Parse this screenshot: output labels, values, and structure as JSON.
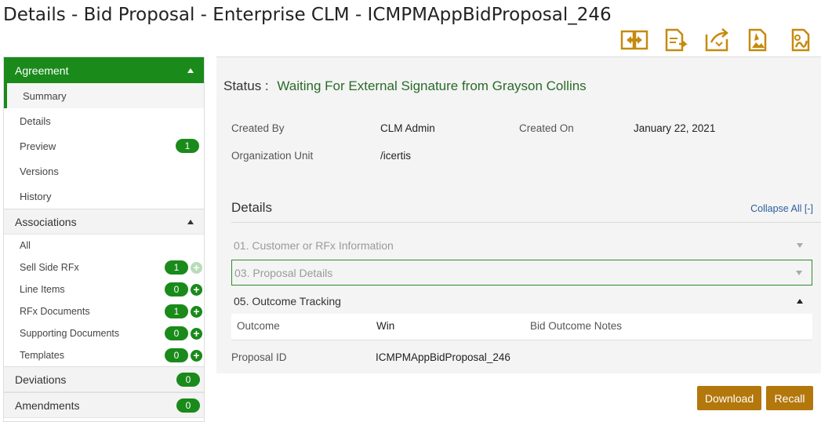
{
  "page_title": "Details - Bid Proposal - Enterprise CLM - ICMPMAppBidProposal_246",
  "toolbar": {
    "icons": [
      "compare-icon",
      "assign-icon",
      "send-icon",
      "image-edit-icon",
      "document-sign-icon"
    ],
    "accent": "#c58a0f"
  },
  "sidebar": {
    "agreement": {
      "label": "Agreement",
      "items": [
        {
          "label": "Summary"
        },
        {
          "label": "Details"
        },
        {
          "label": "Preview",
          "badge": "1"
        },
        {
          "label": "Versions"
        },
        {
          "label": "History"
        }
      ]
    },
    "associations": {
      "label": "Associations",
      "items": [
        {
          "label": "All"
        },
        {
          "label": "Sell Side RFx",
          "badge": "1"
        },
        {
          "label": "Line Items",
          "badge": "0"
        },
        {
          "label": "RFx Documents",
          "badge": "1"
        },
        {
          "label": "Supporting Documents",
          "badge": "0"
        },
        {
          "label": "Templates",
          "badge": "0"
        }
      ]
    },
    "deviations": {
      "label": "Deviations",
      "badge": "0"
    },
    "amendments": {
      "label": "Amendments",
      "badge": "0"
    }
  },
  "main": {
    "status_label": "Status :",
    "status_value": "Waiting For External Signature from Grayson Collins",
    "created_by_label": "Created By",
    "created_by_value": "CLM Admin",
    "created_on_label": "Created On",
    "created_on_value": "January 22, 2021",
    "org_unit_label": "Organization Unit",
    "org_unit_value": "/icertis",
    "details_heading": "Details",
    "collapse_all": "Collapse All [-]",
    "sections": [
      {
        "label": "01. Customer or RFx Information"
      },
      {
        "label": "03. Proposal Details"
      },
      {
        "label": "05. Outcome Tracking"
      }
    ],
    "outcome_label": "Outcome",
    "outcome_value": "Win",
    "bid_outcome_notes_label": "Bid Outcome Notes",
    "proposal_id_label": "Proposal ID",
    "proposal_id_value": "ICMPMAppBidProposal_246"
  },
  "buttons": {
    "download": "Download",
    "recall": "Recall"
  },
  "colors": {
    "brand_green": "#1a8a1a",
    "button_gold": "#b3770c"
  }
}
